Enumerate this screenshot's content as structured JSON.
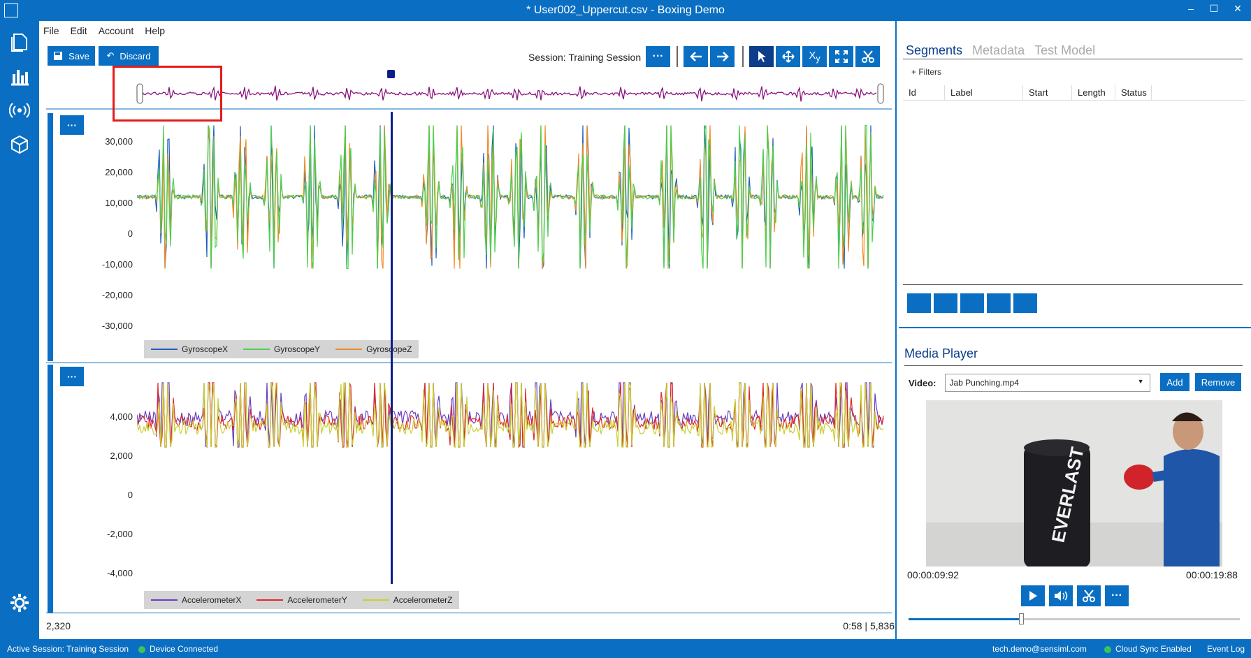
{
  "window": {
    "title": "* User002_Uppercut.csv - Boxing Demo"
  },
  "menu": [
    "File",
    "Edit",
    "Account",
    "Help"
  ],
  "toolbar": {
    "save_label": "Save",
    "discard_label": "Discard",
    "session_label": "Session:",
    "session_value": "Training Session",
    "more_label": "···"
  },
  "gyro_panel": {
    "more_label": "···",
    "yticks": [
      "30,000",
      "20,000",
      "10,000",
      "0",
      "-10,000",
      "-20,000",
      "-30,000"
    ],
    "legend": [
      {
        "name": "GyroscopeX",
        "color": "#1f5fbf"
      },
      {
        "name": "GyroscopeY",
        "color": "#4cd04c"
      },
      {
        "name": "GyroscopeZ",
        "color": "#f08a24"
      }
    ]
  },
  "accel_panel": {
    "more_label": "···",
    "yticks": [
      "4,000",
      "2,000",
      "0",
      "-2,000",
      "-4,000"
    ],
    "legend": [
      {
        "name": "AccelerometerX",
        "color": "#6a3fc0"
      },
      {
        "name": "AccelerometerY",
        "color": "#e0282a"
      },
      {
        "name": "AccelerometerZ",
        "color": "#c8d030"
      }
    ]
  },
  "footer": {
    "position": "2,320",
    "time": "0:58",
    "divider": "|",
    "samples": "5,836"
  },
  "segments": {
    "tabs": [
      "Segments",
      "Metadata",
      "Test Model"
    ],
    "active_tab": "Segments",
    "filters_label": "+ Filters",
    "columns": [
      "Id",
      "Label",
      "Start",
      "Length",
      "Status"
    ]
  },
  "media": {
    "title": "Media Player",
    "video_label": "Video:",
    "video_value": "Jab Punching.mp4",
    "add_label": "Add",
    "remove_label": "Remove",
    "time_current": "00:00:09:92",
    "time_total": "00:00:19:88",
    "bag_text": "EVERLAST"
  },
  "statusbar": {
    "active_session": "Active Session:  Training Session",
    "device": "Device Connected",
    "email": "tech.demo@sensiml.com",
    "cloud": "Cloud Sync Enabled",
    "event_log": "Event Log"
  }
}
